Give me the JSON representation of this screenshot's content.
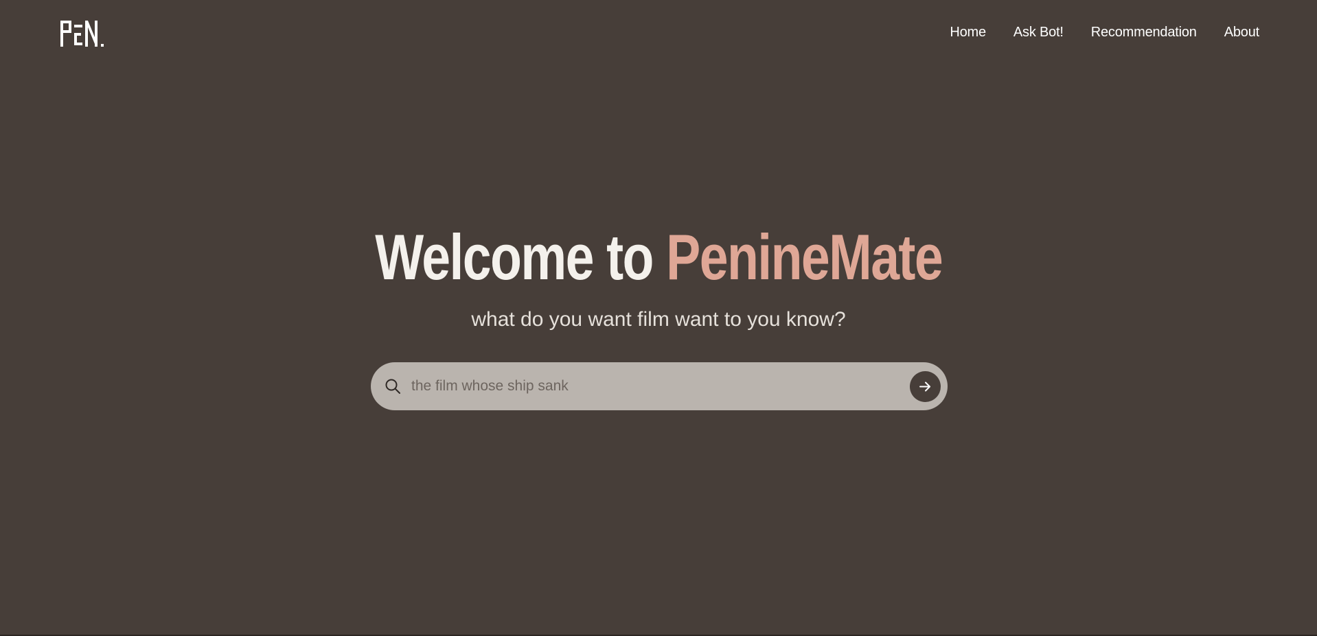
{
  "header": {
    "logo_alt": "PEN.",
    "nav": [
      {
        "label": "Home"
      },
      {
        "label": "Ask Bot!"
      },
      {
        "label": "Recommendation"
      },
      {
        "label": "About"
      }
    ]
  },
  "hero": {
    "title_prefix": "Welcome to ",
    "title_brand": "PenineMate",
    "subtitle": "what do you want film want to you know?"
  },
  "search": {
    "placeholder": "the film whose ship sank",
    "value": "",
    "icon": "search-icon",
    "submit_icon": "arrow-right-icon"
  },
  "colors": {
    "background": "#473e39",
    "accent": "#dfa796",
    "search_bg": "#bab4ae"
  }
}
